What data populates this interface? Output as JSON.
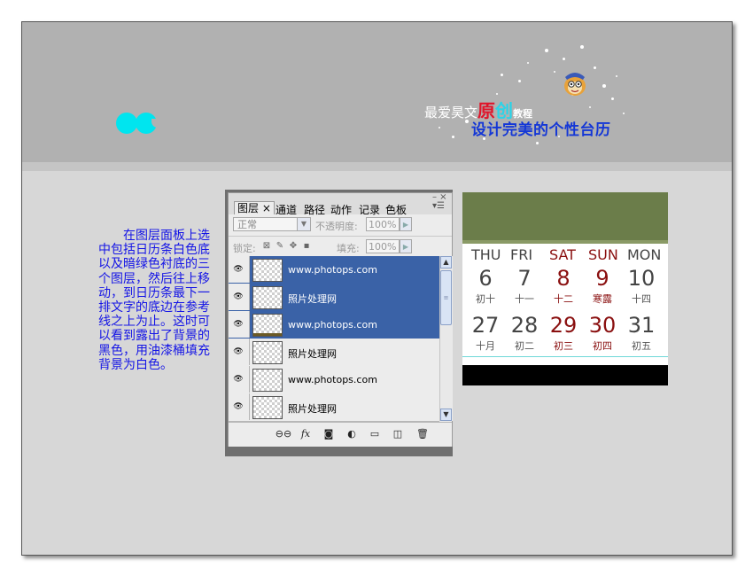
{
  "header": {
    "title_small_1": "最爱昊文",
    "title_big_1": "原",
    "title_big_2": "创",
    "title_small_2": "教程",
    "title_line2": "设计完美的个性台历"
  },
  "instruction": "在图层面板上选中包括日历条白色底以及暗绿色衬底的三个图层，然后往上移动，到日历条最下一排文字的底边在参考线之上为止。这时可以看到露出了背景的黑色，用油漆桶填充背景为白色。",
  "layers_panel": {
    "tabs": [
      "图层 ×",
      "通道",
      "路径",
      "动作",
      "记录",
      "色板"
    ],
    "panel_controls": "– ×",
    "blend_mode": "正常",
    "opacity_label": "不透明度:",
    "opacity_value": "100%",
    "lock_label": "锁定:",
    "fill_label": "填充:",
    "fill_value": "100%",
    "layers": [
      {
        "name": "www.photops.com",
        "selected": true,
        "bar": false
      },
      {
        "name": "照片处理网",
        "selected": true,
        "bar": false
      },
      {
        "name": "www.photops.com",
        "selected": true,
        "bar": true
      },
      {
        "name": "照片处理网",
        "selected": false,
        "bar": false
      },
      {
        "name": "www.photops.com",
        "selected": false,
        "bar": false
      },
      {
        "name": "照片处理网",
        "selected": false,
        "bar": false
      }
    ],
    "bottom_icons": [
      "link-icon",
      "fx-icon",
      "mask-icon",
      "adjustment-icon",
      "folder-icon",
      "new-layer-icon",
      "trash-icon"
    ]
  },
  "calendar": {
    "weekdays": [
      {
        "label": "THU",
        "red": false
      },
      {
        "label": "FRI",
        "red": false
      },
      {
        "label": "SAT",
        "red": true
      },
      {
        "label": "SUN",
        "red": true
      },
      {
        "label": "MON",
        "red": false
      }
    ],
    "row1": [
      {
        "day": "6",
        "lunar": "初十",
        "red": false
      },
      {
        "day": "7",
        "lunar": "十一",
        "red": false
      },
      {
        "day": "8",
        "lunar": "十二",
        "red": true
      },
      {
        "day": "9",
        "lunar": "寒露",
        "red": true
      },
      {
        "day": "10",
        "lunar": "十四",
        "red": false
      }
    ],
    "row2": [
      {
        "day": "27",
        "lunar": "十月",
        "red": false
      },
      {
        "day": "28",
        "lunar": "初二",
        "red": false
      },
      {
        "day": "29",
        "lunar": "初三",
        "red": true
      },
      {
        "day": "30",
        "lunar": "初四",
        "red": true
      },
      {
        "day": "31",
        "lunar": "初五",
        "red": false
      }
    ],
    "colors": {
      "header": "#6b7d4a",
      "red": "#8a1010",
      "guide": "#6fd8d8"
    }
  },
  "colors": {
    "selection": "#3a62a7",
    "logo": "#00e5ef",
    "instruction_text": "#1414e6"
  }
}
